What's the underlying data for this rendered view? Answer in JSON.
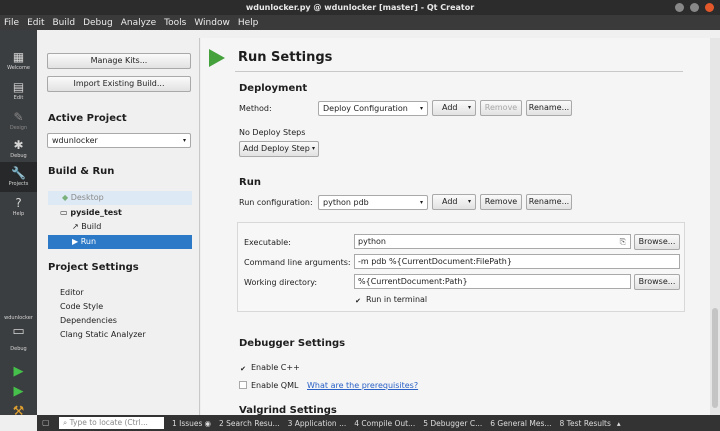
{
  "window": {
    "title": "wdunlocker.py @ wdunlocker [master] - Qt Creator"
  },
  "menu": [
    "File",
    "Edit",
    "Build",
    "Debug",
    "Analyze",
    "Tools",
    "Window",
    "Help"
  ],
  "modes": [
    {
      "label": "Welcome",
      "icon": "grid-icon"
    },
    {
      "label": "Edit",
      "icon": "document-icon"
    },
    {
      "label": "Design",
      "icon": "pen-icon"
    },
    {
      "label": "Debug",
      "icon": "bug-icon"
    },
    {
      "label": "Projects",
      "icon": "wrench-icon"
    },
    {
      "label": "Help",
      "icon": "question-icon"
    }
  ],
  "kit_selector": {
    "project": "wdunlocker",
    "label": "Debug"
  },
  "left": {
    "manage_kits": "Manage Kits...",
    "import_build": "Import Existing Build...",
    "active_project_heading": "Active Project",
    "active_project": "wdunlocker",
    "build_run_heading": "Build & Run",
    "desktop_kit": "Desktop",
    "project_name": "pyside_test",
    "build_item": "Build",
    "run_item": "Run",
    "project_settings_heading": "Project Settings",
    "settings": [
      "Editor",
      "Code Style",
      "Dependencies",
      "Clang Static Analyzer"
    ]
  },
  "main": {
    "title": "Run Settings",
    "deployment": {
      "heading": "Deployment",
      "method_label": "Method:",
      "method_value": "Deploy Configuration",
      "add": "Add",
      "remove": "Remove",
      "rename": "Rename...",
      "no_steps": "No Deploy Steps",
      "add_step": "Add Deploy Step"
    },
    "run": {
      "heading": "Run",
      "config_label": "Run configuration:",
      "config_value": "python pdb",
      "add": "Add",
      "remove": "Remove",
      "rename": "Rename...",
      "executable_label": "Executable:",
      "executable_value": "python",
      "browse": "Browse...",
      "args_label": "Command line arguments:",
      "args_value": "-m pdb %{CurrentDocument:FilePath}",
      "workdir_label": "Working directory:",
      "workdir_value": "%{CurrentDocument:Path}",
      "run_in_terminal": "Run in terminal",
      "run_in_terminal_checked": true
    },
    "debugger": {
      "heading": "Debugger Settings",
      "enable_cpp": "Enable C++",
      "enable_cpp_checked": true,
      "enable_qml": "Enable QML",
      "enable_qml_checked": false,
      "prereq_link": "What are the prerequisites?"
    },
    "valgrind": {
      "heading": "Valgrind Settings"
    }
  },
  "statusbar": {
    "locator_placeholder": "Type to locate (Ctrl...",
    "panes": [
      "1 Issues",
      "2 Search Resu...",
      "3 Application ...",
      "4 Compile Out...",
      "5 Debugger C...",
      "6 General Mes...",
      "8 Test Results"
    ]
  },
  "colors": {
    "accent": "#2c79c7",
    "run_green": "#45a13b",
    "sidebar": "#3b3e40",
    "link": "#2a61c6"
  }
}
